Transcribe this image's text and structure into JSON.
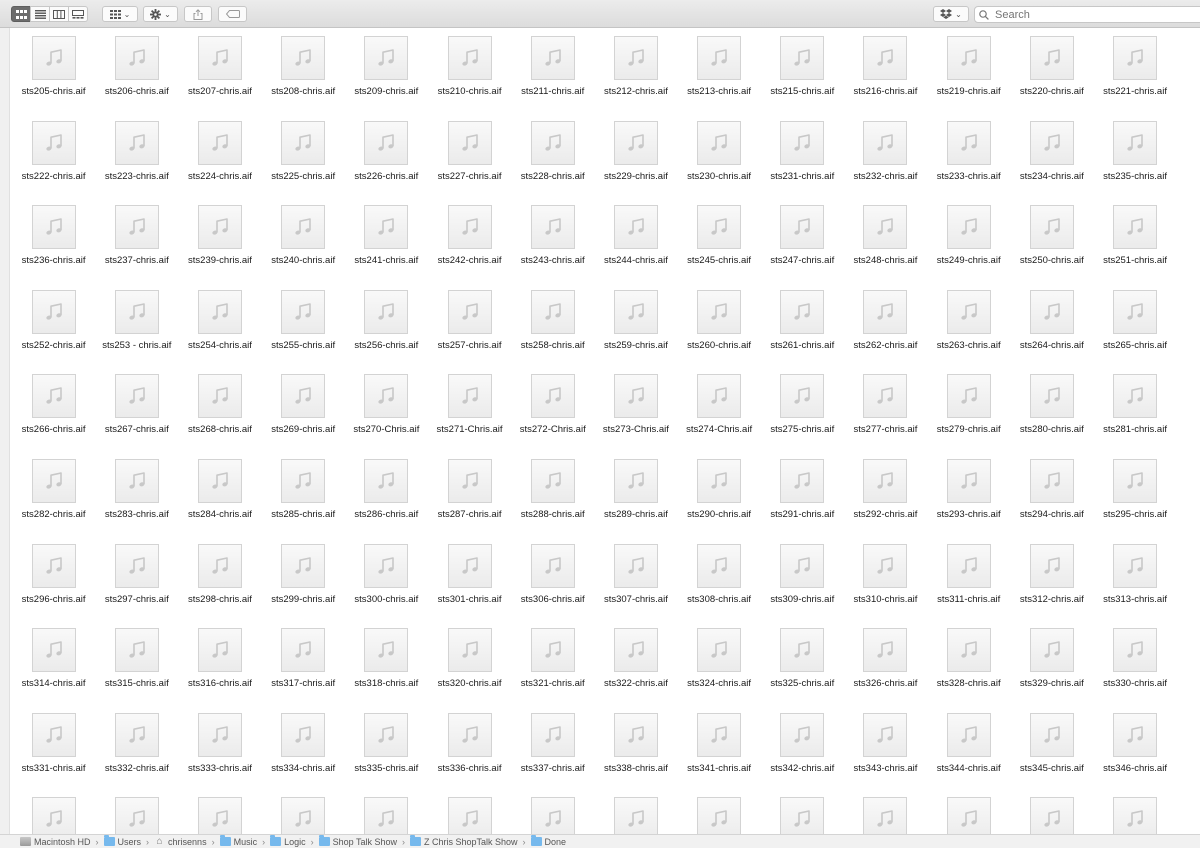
{
  "toolbar": {
    "view_buttons": [
      {
        "name": "icon-view",
        "icon": "grid-icon",
        "active": true
      },
      {
        "name": "list-view",
        "icon": "list-icon",
        "active": false
      },
      {
        "name": "column-view",
        "icon": "columns-icon",
        "active": false
      },
      {
        "name": "gallery-view",
        "icon": "gallery-icon",
        "active": false
      }
    ],
    "search_placeholder": "Search"
  },
  "files": [
    "sts205-chris.aif",
    "sts206-chris.aif",
    "sts207-chris.aif",
    "sts208-chris.aif",
    "sts209-chris.aif",
    "sts210-chris.aif",
    "sts211-chris.aif",
    "sts212-chris.aif",
    "sts213-chris.aif",
    "sts215-chris.aif",
    "sts216-chris.aif",
    "sts219-chris.aif",
    "sts220-chris.aif",
    "sts221-chris.aif",
    "sts222-chris.aif",
    "sts223-chris.aif",
    "sts224-chris.aif",
    "sts225-chris.aif",
    "sts226-chris.aif",
    "sts227-chris.aif",
    "sts228-chris.aif",
    "sts229-chris.aif",
    "sts230-chris.aif",
    "sts231-chris.aif",
    "sts232-chris.aif",
    "sts233-chris.aif",
    "sts234-chris.aif",
    "sts235-chris.aif",
    "sts236-chris.aif",
    "sts237-chris.aif",
    "sts239-chris.aif",
    "sts240-chris.aif",
    "sts241-chris.aif",
    "sts242-chris.aif",
    "sts243-chris.aif",
    "sts244-chris.aif",
    "sts245-chris.aif",
    "sts247-chris.aif",
    "sts248-chris.aif",
    "sts249-chris.aif",
    "sts250-chris.aif",
    "sts251-chris.aif",
    "sts252-chris.aif",
    "sts253 - chris.aif",
    "sts254-chris.aif",
    "sts255-chris.aif",
    "sts256-chris.aif",
    "sts257-chris.aif",
    "sts258-chris.aif",
    "sts259-chris.aif",
    "sts260-chris.aif",
    "sts261-chris.aif",
    "sts262-chris.aif",
    "sts263-chris.aif",
    "sts264-chris.aif",
    "sts265-chris.aif",
    "sts266-chris.aif",
    "sts267-chris.aif",
    "sts268-chris.aif",
    "sts269-chris.aif",
    "sts270-Chris.aif",
    "sts271-Chris.aif",
    "sts272-Chris.aif",
    "sts273-Chris.aif",
    "sts274-Chris.aif",
    "sts275-chris.aif",
    "sts277-chris.aif",
    "sts279-chris.aif",
    "sts280-chris.aif",
    "sts281-chris.aif",
    "sts282-chris.aif",
    "sts283-chris.aif",
    "sts284-chris.aif",
    "sts285-chris.aif",
    "sts286-chris.aif",
    "sts287-chris.aif",
    "sts288-chris.aif",
    "sts289-chris.aif",
    "sts290-chris.aif",
    "sts291-chris.aif",
    "sts292-chris.aif",
    "sts293-chris.aif",
    "sts294-chris.aif",
    "sts295-chris.aif",
    "sts296-chris.aif",
    "sts297-chris.aif",
    "sts298-chris.aif",
    "sts299-chris.aif",
    "sts300-chris.aif",
    "sts301-chris.aif",
    "sts306-chris.aif",
    "sts307-chris.aif",
    "sts308-chris.aif",
    "sts309-chris.aif",
    "sts310-chris.aif",
    "sts311-chris.aif",
    "sts312-chris.aif",
    "sts313-chris.aif",
    "sts314-chris.aif",
    "sts315-chris.aif",
    "sts316-chris.aif",
    "sts317-chris.aif",
    "sts318-chris.aif",
    "sts320-chris.aif",
    "sts321-chris.aif",
    "sts322-chris.aif",
    "sts324-chris.aif",
    "sts325-chris.aif",
    "sts326-chris.aif",
    "sts328-chris.aif",
    "sts329-chris.aif",
    "sts330-chris.aif",
    "sts331-chris.aif",
    "sts332-chris.aif",
    "sts333-chris.aif",
    "sts334-chris.aif",
    "sts335-chris.aif",
    "sts336-chris.aif",
    "sts337-chris.aif",
    "sts338-chris.aif",
    "sts341-chris.aif",
    "sts342-chris.aif",
    "sts343-chris.aif",
    "sts344-chris.aif",
    "sts345-chris.aif",
    "sts346-chris.aif",
    "",
    "",
    "",
    "",
    "",
    "",
    "",
    "",
    "",
    "",
    "",
    "",
    "",
    ""
  ],
  "file_icon": "music-note-icon",
  "pathbar": {
    "crumbs": [
      {
        "label": "Macintosh HD",
        "icon": "disk-icon"
      },
      {
        "label": "Users",
        "icon": "folder-icon"
      },
      {
        "label": "chrisenns",
        "icon": "home-icon"
      },
      {
        "label": "Music",
        "icon": "folder-icon"
      },
      {
        "label": "Logic",
        "icon": "folder-icon"
      },
      {
        "label": "Shop Talk Show",
        "icon": "folder-icon"
      },
      {
        "label": "Z Chris ShopTalk Show",
        "icon": "folder-icon"
      },
      {
        "label": "Done",
        "icon": "folder-icon"
      }
    ],
    "separator": "›"
  },
  "colors": {
    "toolbar_active": "#6c6c6c",
    "folder_blue": "#76b9ed",
    "icon_bg": "#f2f2f2",
    "music_note": "#c4c4c4"
  }
}
